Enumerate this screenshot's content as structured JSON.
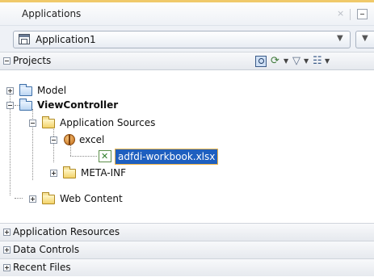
{
  "panel": {
    "title": "Applications",
    "close_glyph": "×",
    "colors": {
      "accent": "#f0c96a",
      "selection": "#1e5fbf",
      "header_bg": "#e6e9ee"
    }
  },
  "app_selector": {
    "selected": "Application1",
    "dropdown_glyph": "▼"
  },
  "projects": {
    "label": "Projects",
    "toolbar": {
      "filter_icon": "filter-view-icon",
      "sync_icon": "sync-icon",
      "sync_glyph": "⟳",
      "funnel_glyph": "▽",
      "tree_options_glyph": "☷",
      "menu_arrow_glyph": "▼"
    }
  },
  "tree": {
    "model": "Model",
    "viewcontroller": "ViewController",
    "application_sources": "Application Sources",
    "excel": "excel",
    "workbook": "adfdi-workbook.xlsx",
    "meta_inf": "META-INF",
    "web_content": "Web Content"
  },
  "sections": [
    {
      "label": "Application Resources"
    },
    {
      "label": "Data Controls"
    },
    {
      "label": "Recent Files"
    }
  ]
}
